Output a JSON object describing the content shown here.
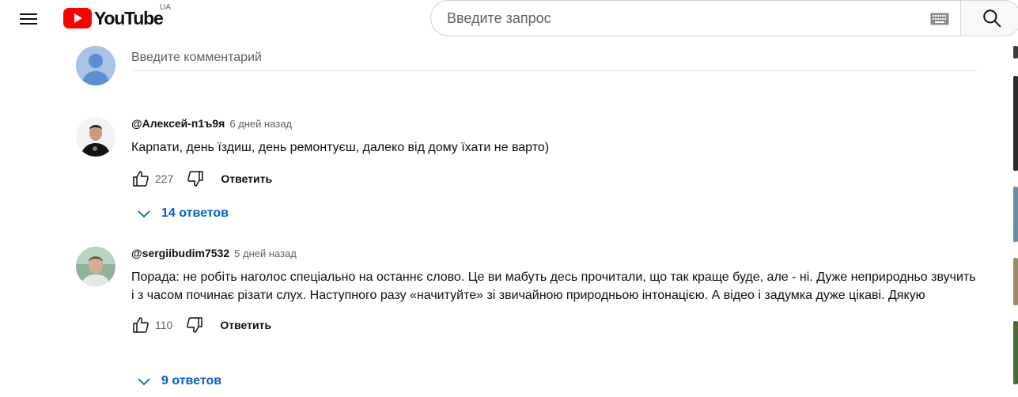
{
  "header": {
    "logo_text": "YouTube",
    "country_code": "UA",
    "search_placeholder": "Введите запрос"
  },
  "add_comment": {
    "placeholder": "Введите комментарий"
  },
  "comments": [
    {
      "author": "@Алексей-п1ъ9я",
      "time": "6 дней назад",
      "text": "Карпати, день їздиш, день ремонтуєш, далеко від дому їхати не варто)",
      "likes": "227",
      "reply_label": "Ответить",
      "replies_label": "14 ответов"
    },
    {
      "author": "@sergiibudim7532",
      "time": "5 дней назад",
      "text": "Порада: не робіть наголос спеціально на останнє слово. Це ви мабуть десь прочитали, що так краще буде, але - ні. Дуже неприродньо звучить і з часом починає різати слух. Наступного разу «начитуйте» зі звичайною природньою інтонацією. А відео і задумка дуже цікаві. Дякую",
      "likes": "110",
      "reply_label": "Ответить",
      "replies_label": "9 ответов"
    }
  ],
  "colors": {
    "brand_red": "#ff0000",
    "link_blue": "#065fd4",
    "secondary_text": "#606060"
  },
  "icons": [
    "menu-icon",
    "youtube-logo-icon",
    "keyboard-icon",
    "search-icon",
    "like-icon",
    "dislike-icon",
    "chevron-down-icon"
  ]
}
